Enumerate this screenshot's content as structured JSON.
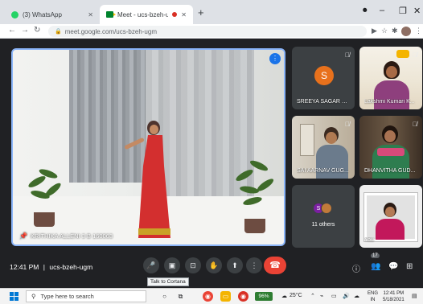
{
  "browser": {
    "tabs": [
      {
        "label": "(3) WhatsApp",
        "active": false
      },
      {
        "label": "Meet - ucs-bzeh-ugm",
        "active": true
      }
    ],
    "new_tab": "+",
    "url": "meet.google.com/ucs-bzeh-ugm"
  },
  "meet": {
    "main_participant": "KRITHIKA ALLENI 3 B 160063",
    "participants": [
      {
        "name": "SREEYA SAGAR ME...",
        "initial": "S"
      },
      {
        "name": "Lakshmi Kumari K..."
      },
      {
        "name": "SAI AARNAV GUG..."
      },
      {
        "name": "DHANVITHA GUD..."
      },
      {
        "name": "11 others",
        "initials": [
          "S",
          ""
        ]
      },
      {
        "name": "You"
      }
    ],
    "time": "12:41 PM",
    "separator": "|",
    "meeting_code": "ucs-bzeh-ugm",
    "tooltip": "Talk to Cortana",
    "participant_count": "17"
  },
  "taskbar": {
    "search_placeholder": "Type here to search",
    "battery": "96%",
    "temperature": "25°C",
    "language": "ENG",
    "region": "IN",
    "clock_time": "12:41 PM",
    "clock_date": "5/18/2021"
  },
  "colors": {
    "meet_bg": "#202124",
    "accent": "#8ab4f8",
    "end_call": "#ea4335"
  }
}
